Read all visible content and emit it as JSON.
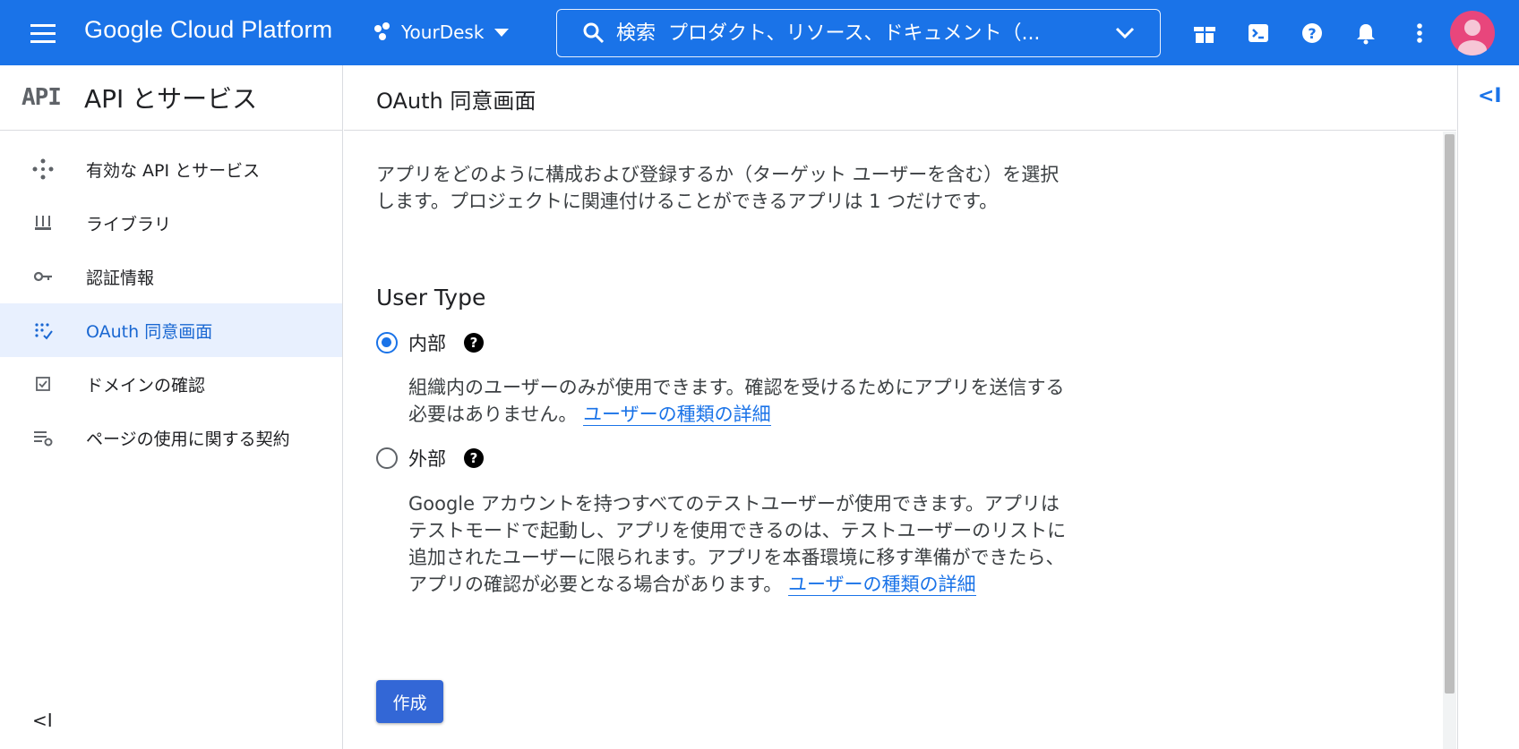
{
  "topbar": {
    "brand": "Google Cloud Platform",
    "project": "YourDesk",
    "search_placeholder": "検索  プロダクト、リソース、ドキュメント（..."
  },
  "sidenav": {
    "logo_text": "API",
    "title": "API とサービス",
    "items": [
      {
        "label": "有効な API とサービス",
        "icon": "diamond-dots-icon"
      },
      {
        "label": "ライブラリ",
        "icon": "library-icon"
      },
      {
        "label": "認証情報",
        "icon": "key-icon"
      },
      {
        "label": "OAuth 同意画面",
        "icon": "consent-icon",
        "active": true
      },
      {
        "label": "ドメインの確認",
        "icon": "checkbox-icon"
      },
      {
        "label": "ページの使用に関する契約",
        "icon": "settings-list-icon"
      }
    ],
    "collapse_glyph": "<I"
  },
  "page": {
    "title": "OAuth 同意画面",
    "intro": "アプリをどのように構成および登録するか（ターゲット ユーザーを含む）を選択します。プロジェクトに関連付けることができるアプリは 1 つだけです。",
    "user_type_title": "User Type",
    "options": [
      {
        "label": "内部",
        "checked": true,
        "description": "組織内のユーザーのみが使用できます。確認を受けるためにアプリを送信する必要はありません。",
        "link": "ユーザーの種類の詳細"
      },
      {
        "label": "外部",
        "checked": false,
        "description": "Google アカウントを持つすべてのテストユーザーが使用できます。アプリはテストモードで起動し、アプリを使用できるのは、テストユーザーのリストに追加されたユーザーに限られます。アプリを本番環境に移す準備ができたら、アプリの確認が必要となる場合があります。",
        "link": "ユーザーの種類の詳細"
      }
    ],
    "help_glyph": "?",
    "create_button": "作成"
  },
  "right_panel": {
    "collapse_glyph": "<I"
  },
  "colors": {
    "topbar": "#1a73e8",
    "active_nav_bg": "#e8f0fe",
    "link": "#1a73e8",
    "button": "#3367d6",
    "avatar": "#e8467c"
  }
}
